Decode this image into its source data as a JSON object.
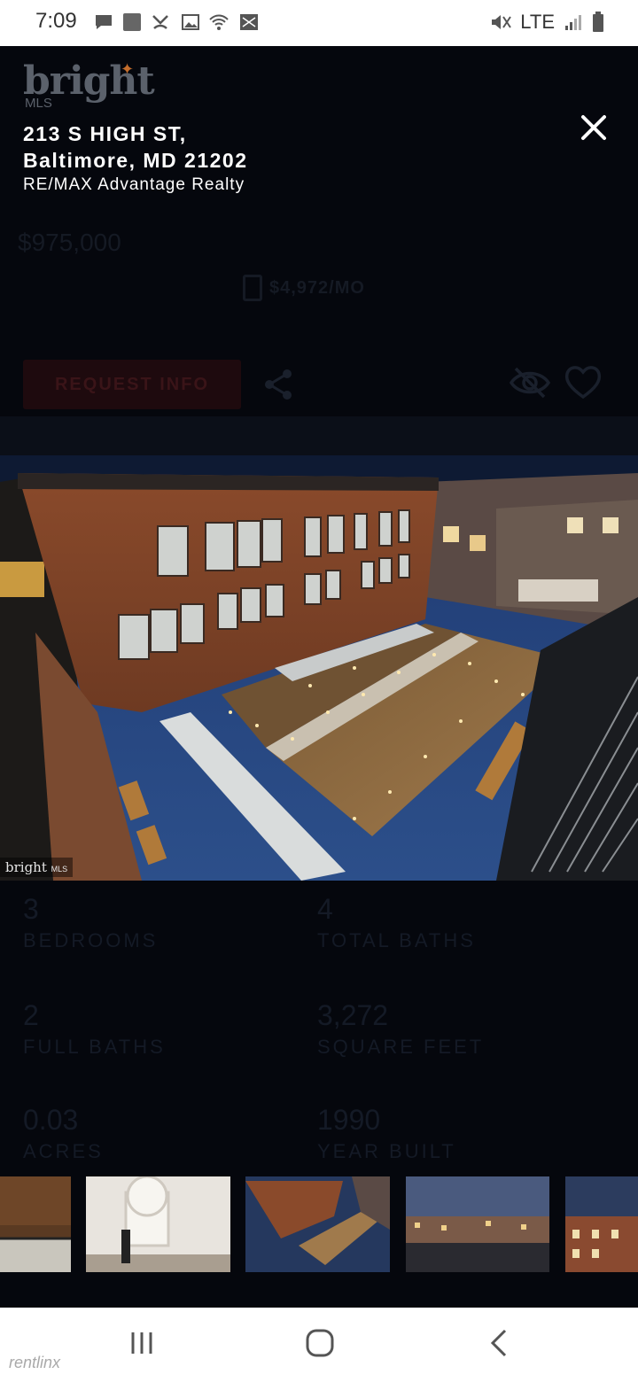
{
  "status_bar": {
    "time": "7:09",
    "network": "LTE"
  },
  "under": {
    "logo": "bright",
    "logo_sub": "MLS",
    "price": "$975,000",
    "mortgage": "$4,972/MO",
    "request_button": "REQUEST INFO",
    "stats": [
      {
        "value": "3",
        "label": "BEDROOMS"
      },
      {
        "value": "4",
        "label": "TOTAL BATHS"
      },
      {
        "value": "2",
        "label": "FULL BATHS"
      },
      {
        "value": "3,272",
        "label": "SQUARE FEET"
      },
      {
        "value": "0.03",
        "label": "ACRES"
      },
      {
        "value": "1990",
        "label": "YEAR BUILT"
      }
    ]
  },
  "gallery": {
    "address_line1": "213 S HIGH ST,",
    "address_line2": "Baltimore, MD 21202",
    "agency": "RE/MAX Advantage Realty",
    "watermark": "bright",
    "watermark_sub": "MLS"
  },
  "footer": {
    "brand": "rentlinx"
  },
  "colors": {
    "overlay": "#05070d",
    "accent": "#c0392b"
  }
}
